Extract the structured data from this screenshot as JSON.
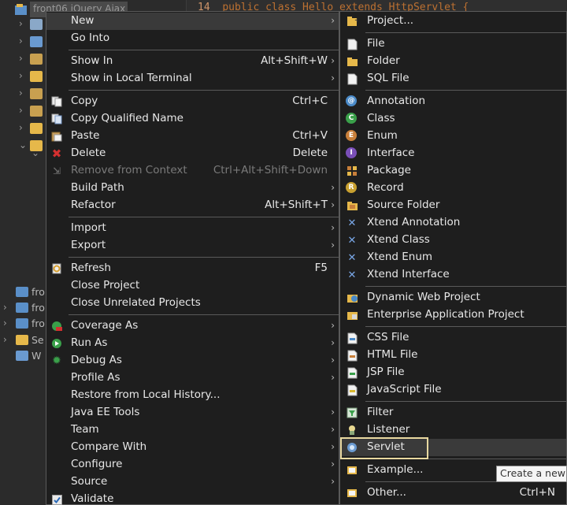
{
  "tree": {
    "selected_project": "front06 jQuery Ajax",
    "bottom_items": [
      "fro",
      "fro",
      "fro",
      "Se",
      "W"
    ]
  },
  "editor": {
    "line_number": "14",
    "code": "public class Hello extends HttpServlet {"
  },
  "context_menu": {
    "items": [
      {
        "label": "New",
        "submenu": true,
        "icon": "none"
      },
      {
        "label": "Go Into",
        "icon": "none"
      },
      {
        "label": "Show In",
        "shortcut": "Alt+Shift+W",
        "submenu": true
      },
      {
        "label": "Show in Local Terminal",
        "submenu": true
      },
      {
        "label": "Copy",
        "shortcut": "Ctrl+C",
        "icon": "copy-icon"
      },
      {
        "label": "Copy Qualified Name",
        "icon": "copy-qualified-icon"
      },
      {
        "label": "Paste",
        "shortcut": "Ctrl+V",
        "icon": "paste-icon"
      },
      {
        "label": "Delete",
        "shortcut": "Delete",
        "icon": "delete-icon"
      },
      {
        "label": "Remove from Context",
        "shortcut": "Ctrl+Alt+Shift+Down",
        "disabled": true,
        "icon": "remove-context-icon"
      },
      {
        "label": "Build Path",
        "submenu": true
      },
      {
        "label": "Refactor",
        "shortcut": "Alt+Shift+T",
        "submenu": true
      },
      {
        "label": "Import",
        "submenu": true
      },
      {
        "label": "Export",
        "submenu": true
      },
      {
        "label": "Refresh",
        "shortcut": "F5",
        "icon": "refresh-icon"
      },
      {
        "label": "Close Project"
      },
      {
        "label": "Close Unrelated Projects"
      },
      {
        "label": "Coverage As",
        "submenu": true,
        "icon": "coverage-icon"
      },
      {
        "label": "Run As",
        "submenu": true,
        "icon": "run-icon"
      },
      {
        "label": "Debug As",
        "submenu": true,
        "icon": "debug-icon"
      },
      {
        "label": "Profile As",
        "submenu": true
      },
      {
        "label": "Restore from Local History..."
      },
      {
        "label": "Java EE Tools",
        "submenu": true
      },
      {
        "label": "Team",
        "submenu": true
      },
      {
        "label": "Compare With",
        "submenu": true
      },
      {
        "label": "Configure",
        "submenu": true
      },
      {
        "label": "Source",
        "submenu": true
      },
      {
        "label": "Validate",
        "icon": "check-icon"
      }
    ]
  },
  "new_submenu": {
    "items": [
      {
        "label": "Project...",
        "icon": "project-icon"
      },
      {
        "label": "File",
        "icon": "file-icon"
      },
      {
        "label": "Folder",
        "icon": "folder-icon"
      },
      {
        "label": "SQL File",
        "icon": "sql-file-icon"
      },
      {
        "label": "Annotation",
        "icon": "annotation-icon"
      },
      {
        "label": "Class",
        "icon": "class-icon"
      },
      {
        "label": "Enum",
        "icon": "enum-icon"
      },
      {
        "label": "Interface",
        "icon": "interface-icon"
      },
      {
        "label": "Package",
        "icon": "package-icon"
      },
      {
        "label": "Record",
        "icon": "record-icon"
      },
      {
        "label": "Source Folder",
        "icon": "source-folder-icon"
      },
      {
        "label": "Xtend Annotation",
        "icon": "xtend-icon"
      },
      {
        "label": "Xtend Class",
        "icon": "xtend-icon"
      },
      {
        "label": "Xtend Enum",
        "icon": "xtend-icon"
      },
      {
        "label": "Xtend Interface",
        "icon": "xtend-icon"
      },
      {
        "label": "Dynamic Web Project",
        "icon": "web-project-icon"
      },
      {
        "label": "Enterprise Application Project",
        "icon": "ear-project-icon"
      },
      {
        "label": "CSS File",
        "icon": "css-file-icon"
      },
      {
        "label": "HTML File",
        "icon": "html-file-icon"
      },
      {
        "label": "JSP File",
        "icon": "jsp-file-icon"
      },
      {
        "label": "JavaScript File",
        "icon": "js-file-icon"
      },
      {
        "label": "Filter",
        "icon": "filter-icon"
      },
      {
        "label": "Listener",
        "icon": "listener-icon"
      },
      {
        "label": "Servlet",
        "icon": "servlet-icon"
      },
      {
        "label": "Example...",
        "icon": "example-icon"
      },
      {
        "label": "Other...",
        "shortcut": "Ctrl+N",
        "icon": "other-icon"
      }
    ]
  },
  "tooltip": "Create a new",
  "colors": {
    "menu_bg": "#1e1e1e",
    "highlight": "#3a3a3a",
    "selection_box": "#e8d8a0",
    "class_green": "#3aa04a",
    "enum_orange": "#c87f3a",
    "interface_purple": "#7a4fb8",
    "delete_red": "#d43030"
  }
}
